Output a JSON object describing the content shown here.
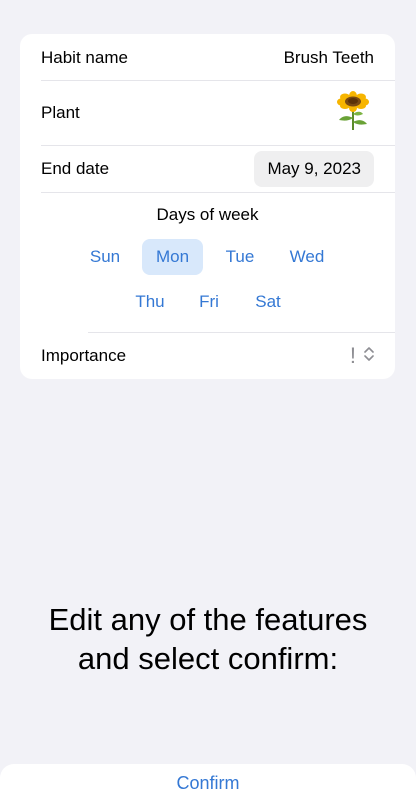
{
  "form": {
    "habit_label": "Habit name",
    "habit_value": "Brush  Teeth",
    "plant_label": "Plant",
    "plant_icon": "sunflower-icon",
    "end_date_label": "End date",
    "end_date_value": "May 9, 2023",
    "days_title": "Days of week",
    "days": [
      {
        "label": "Sun",
        "selected": false
      },
      {
        "label": "Mon",
        "selected": true
      },
      {
        "label": "Tue",
        "selected": false
      },
      {
        "label": "Wed",
        "selected": false
      },
      {
        "label": "Thu",
        "selected": false
      },
      {
        "label": "Fri",
        "selected": false
      },
      {
        "label": "Sat",
        "selected": false
      }
    ],
    "importance_label": "Importance",
    "importance_value": "!"
  },
  "instructions": "Edit any of the features and select confirm:",
  "confirm_label": "Confirm",
  "colors": {
    "background": "#f2f2f7",
    "accent": "#3478d4",
    "selected_day_bg": "#d8e8fb"
  }
}
